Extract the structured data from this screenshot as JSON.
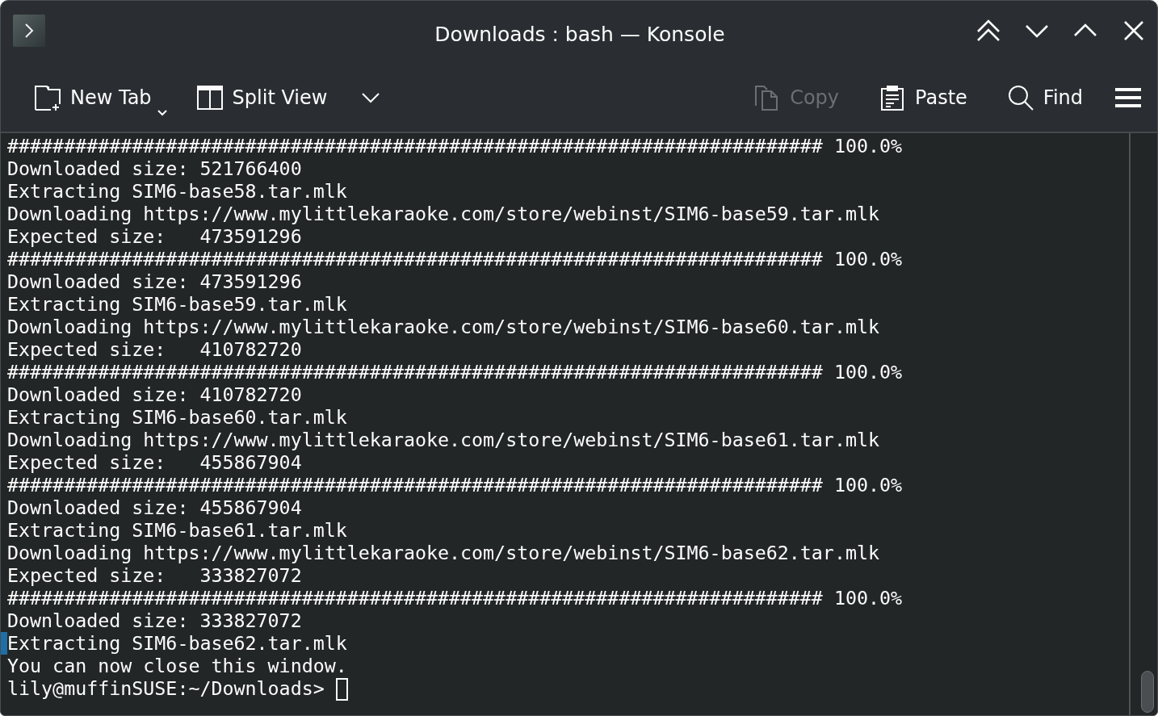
{
  "window": {
    "title": "Downloads : bash — Konsole"
  },
  "toolbar": {
    "buttons": [
      {
        "kind": "new-tab",
        "label": "New Tab",
        "disabled": false,
        "menu": true
      },
      {
        "kind": "split-view",
        "label": "Split View",
        "disabled": false,
        "menu": true
      },
      {
        "kind": "copy",
        "label": "Copy",
        "disabled": true,
        "menu": false
      },
      {
        "kind": "paste",
        "label": "Paste",
        "disabled": false,
        "menu": false
      },
      {
        "kind": "find",
        "label": "Find",
        "disabled": false,
        "menu": false
      }
    ]
  },
  "terminal": {
    "lines": [
      {
        "text": "######################################################################## 100.0%",
        "marked": false
      },
      {
        "text": "Downloaded size: 521766400",
        "marked": false
      },
      {
        "text": "Extracting SIM6-base58.tar.mlk",
        "marked": false
      },
      {
        "text": "Downloading https://www.mylittlekaraoke.com/store/webinst/SIM6-base59.tar.mlk",
        "marked": false
      },
      {
        "text": "Expected size:   473591296",
        "marked": false
      },
      {
        "text": "######################################################################## 100.0%",
        "marked": false
      },
      {
        "text": "Downloaded size: 473591296",
        "marked": false
      },
      {
        "text": "Extracting SIM6-base59.tar.mlk",
        "marked": false
      },
      {
        "text": "Downloading https://www.mylittlekaraoke.com/store/webinst/SIM6-base60.tar.mlk",
        "marked": false
      },
      {
        "text": "Expected size:   410782720",
        "marked": false
      },
      {
        "text": "######################################################################## 100.0%",
        "marked": false
      },
      {
        "text": "Downloaded size: 410782720",
        "marked": false
      },
      {
        "text": "Extracting SIM6-base60.tar.mlk",
        "marked": false
      },
      {
        "text": "Downloading https://www.mylittlekaraoke.com/store/webinst/SIM6-base61.tar.mlk",
        "marked": false
      },
      {
        "text": "Expected size:   455867904",
        "marked": false
      },
      {
        "text": "######################################################################## 100.0%",
        "marked": false
      },
      {
        "text": "Downloaded size: 455867904",
        "marked": false
      },
      {
        "text": "Extracting SIM6-base61.tar.mlk",
        "marked": false
      },
      {
        "text": "Downloading https://www.mylittlekaraoke.com/store/webinst/SIM6-base62.tar.mlk",
        "marked": false
      },
      {
        "text": "Expected size:   333827072",
        "marked": false
      },
      {
        "text": "######################################################################## 100.0%",
        "marked": false
      },
      {
        "text": "Downloaded size: 333827072",
        "marked": false
      },
      {
        "text": "Extracting SIM6-base62.tar.mlk",
        "marked": true
      },
      {
        "text": "You can now close this window.",
        "marked": false
      }
    ],
    "prompt": "lily@muffinSUSE:~/Downloads>",
    "cursor": true
  }
}
